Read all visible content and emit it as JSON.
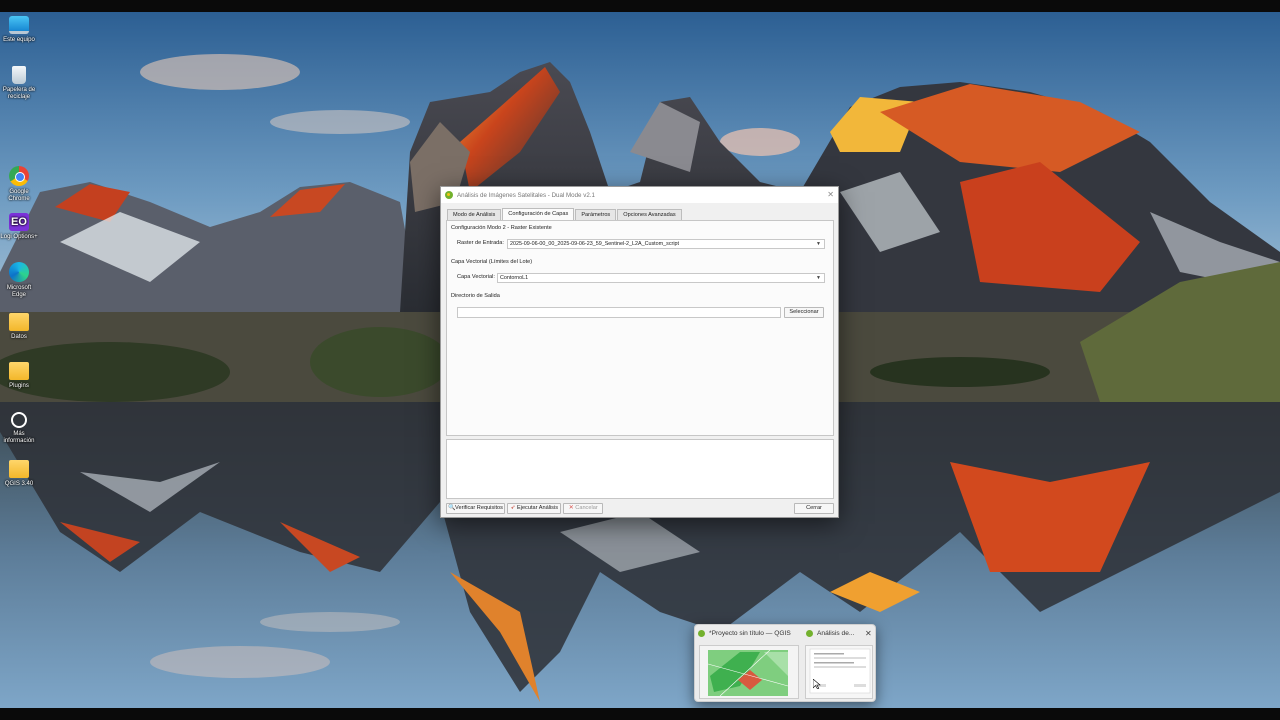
{
  "desktop": {
    "icons": [
      {
        "label": "Este equipo",
        "icon": "monitor-icon"
      },
      {
        "label": "Papelera de reciclaje",
        "icon": "recycle-bin-icon"
      },
      {
        "label": "Google Chrome",
        "icon": "chrome-icon"
      },
      {
        "label": "Logi Options+",
        "icon": "eo-app-icon"
      },
      {
        "label": "Microsoft Edge",
        "icon": "edge-icon"
      },
      {
        "label": "Datos",
        "icon": "folder-icon"
      },
      {
        "label": "Plugins",
        "icon": "folder-icon"
      },
      {
        "label": "Más información",
        "icon": "info-icon"
      },
      {
        "label": "QGIS 3.40",
        "icon": "folder-icon"
      }
    ]
  },
  "dialog": {
    "title": "Análisis de Imágenes Satelitales - Dual Mode v2.1",
    "tabs": [
      "Modo de Análisis",
      "Configuración de Capas",
      "Parámetros",
      "Opciones Avanzadas"
    ],
    "active_tab": "Configuración de Capas",
    "mode_section": "Configuración Modo 2 - Raster Existente",
    "raster_label": "Raster de Entrada:",
    "raster_value": "2025-09-06-00_00_2025-09-06-23_59_Sentinel-2_L2A_Custom_script",
    "vector_section": "Capa Vectorial (Límites del Lote)",
    "vector_label": "Capa Vectorial:",
    "vector_value": "ContornoL1",
    "output_section": "Directorio de Salida",
    "output_value": "",
    "select_button": "Seleccionar",
    "verify_button": "Verificar Requisitos",
    "run_button": "Ejecutar Análisis",
    "cancel_button": "Cancelar",
    "close_button": "Cerrar"
  },
  "taskbar_preview": {
    "items": [
      {
        "title": "*Proyecto sin título — QGIS"
      },
      {
        "title": "Análisis de..."
      }
    ]
  },
  "colors": {
    "qgis_green": "#73b12d",
    "dialog_bg": "#f0f0f0"
  }
}
